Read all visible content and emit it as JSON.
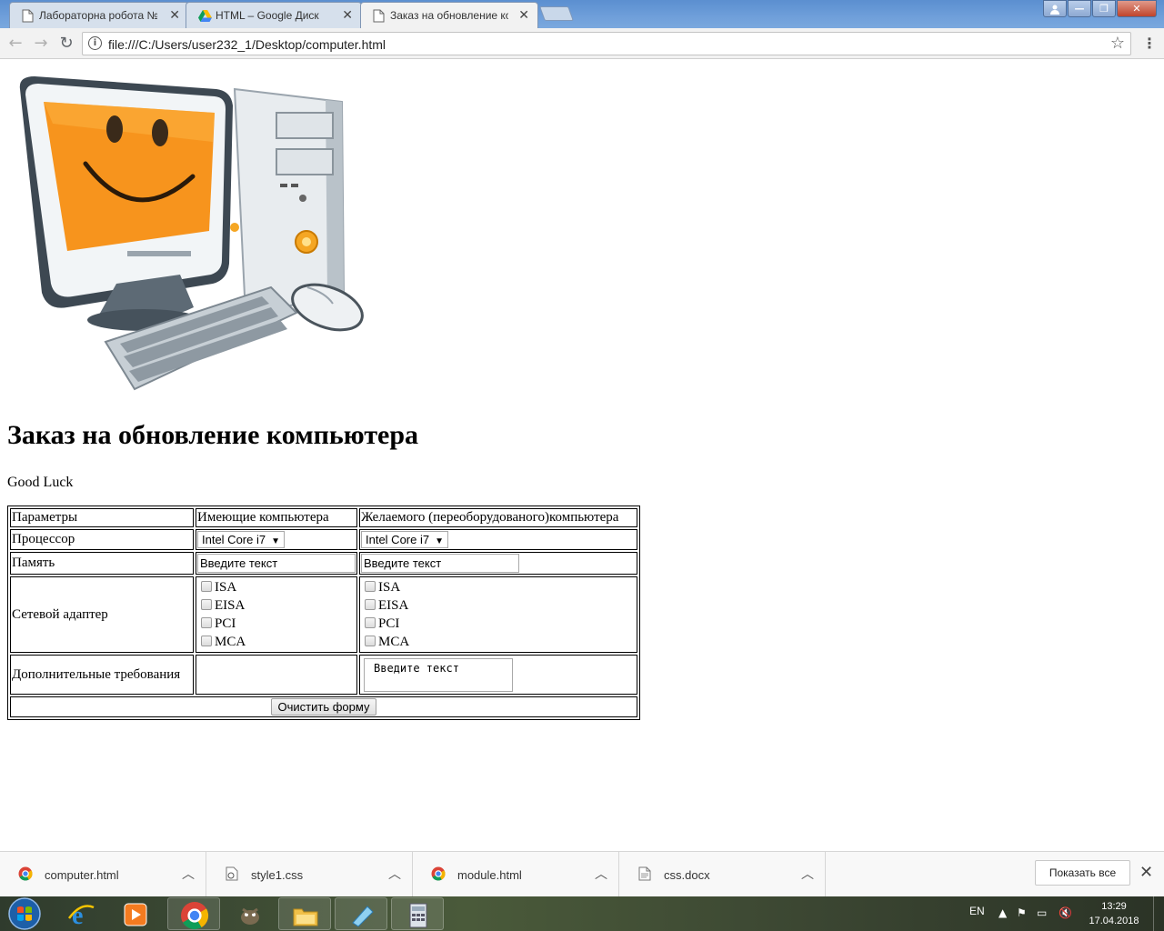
{
  "browser": {
    "tabs": [
      {
        "label": "Лабораторна робота №",
        "icon": "document-icon"
      },
      {
        "label": "HTML – Google Диск",
        "icon": "google-drive-icon"
      },
      {
        "label": "Заказ на обновление ко",
        "icon": "document-icon",
        "active": true
      }
    ],
    "url": "file:///C:/Users/user232_1/Desktop/computer.html"
  },
  "page": {
    "image_alt": "computer illustration",
    "title": "Заказ на обновление компьютера",
    "subtitle": "Good Luck",
    "table": {
      "headers": [
        "Параметры",
        "Имеющие компьютера",
        "Желаемого (переоборудованого)компьютера"
      ],
      "processor_label": "Процессор",
      "processor_current": "Intel Core i7",
      "processor_desired": "Intel Core i7",
      "memory_label": "Память",
      "memory_placeholder": "Введите текст",
      "network_label": "Сетевой адаптер",
      "network_options": [
        "ISA",
        "EISA",
        "PCI",
        "MCA"
      ],
      "extra_label": "Дополнительные требования",
      "extra_placeholder": "Введите текст",
      "clear_button": "Очистить форму"
    }
  },
  "downloads": {
    "items": [
      {
        "name": "computer.html",
        "icon": "chrome-icon"
      },
      {
        "name": "style1.css",
        "icon": "css-file-icon"
      },
      {
        "name": "module.html",
        "icon": "chrome-icon"
      },
      {
        "name": "css.docx",
        "icon": "document-icon"
      }
    ],
    "show_all": "Показать все"
  },
  "taskbar": {
    "language": "EN",
    "time": "13:29",
    "date": "17.04.2018"
  },
  "colors": {
    "titlebar": "#6f9fda",
    "taskbar": "#3b4632",
    "screen_orange": "#f7941d"
  }
}
